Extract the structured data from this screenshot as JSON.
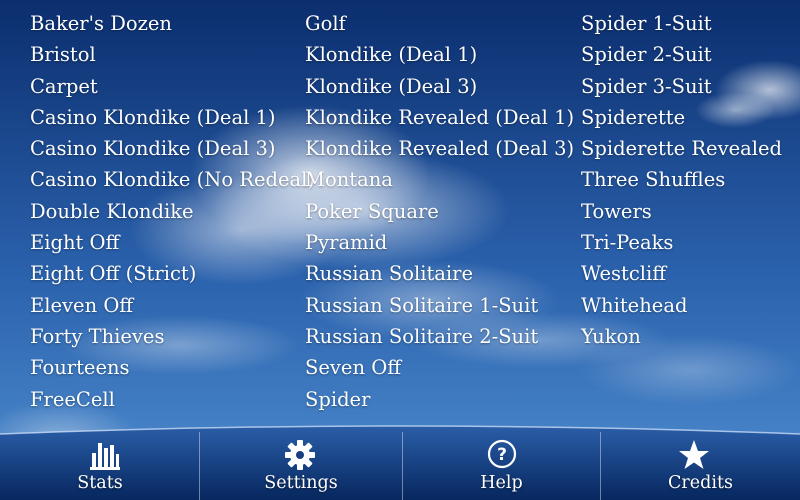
{
  "games": {
    "column1": [
      "Baker's Dozen",
      "Bristol",
      "Carpet",
      "Casino Klondike (Deal 1)",
      "Casino Klondike (Deal 3)",
      "Casino Klondike (No Redeal)",
      "Double Klondike",
      "Eight Off",
      "Eight Off (Strict)",
      "Eleven Off",
      "Forty Thieves",
      "Fourteens",
      "FreeCell"
    ],
    "column2": [
      "Golf",
      "Klondike (Deal 1)",
      "Klondike (Deal 3)",
      "Klondike Revealed (Deal 1)",
      "Klondike Revealed (Deal 3)",
      "Montana",
      "Poker Square",
      "Pyramid",
      "Russian Solitaire",
      "Russian Solitaire 1-Suit",
      "Russian Solitaire 2-Suit",
      "Seven Off",
      "Spider"
    ],
    "column3": [
      "Spider 1-Suit",
      "Spider 2-Suit",
      "Spider 3-Suit",
      "Spiderette",
      "Spiderette Revealed",
      "Three Shuffles",
      "Towers",
      "Tri-Peaks",
      "Westcliff",
      "Whitehead",
      "Yukon"
    ]
  },
  "toolbar": {
    "stats": {
      "label": "Stats",
      "icon": "bar-chart-icon"
    },
    "settings": {
      "label": "Settings",
      "icon": "gear-icon"
    },
    "help": {
      "label": "Help",
      "icon": "question-circle-icon"
    },
    "credits": {
      "label": "Credits",
      "icon": "star-icon"
    }
  },
  "colors": {
    "sky_top": "#0b2e6e",
    "sky_mid": "#3f7fc4",
    "toolbar_top": "#1d4f9a",
    "toolbar_bottom": "#082a66",
    "text": "#ffffff"
  }
}
